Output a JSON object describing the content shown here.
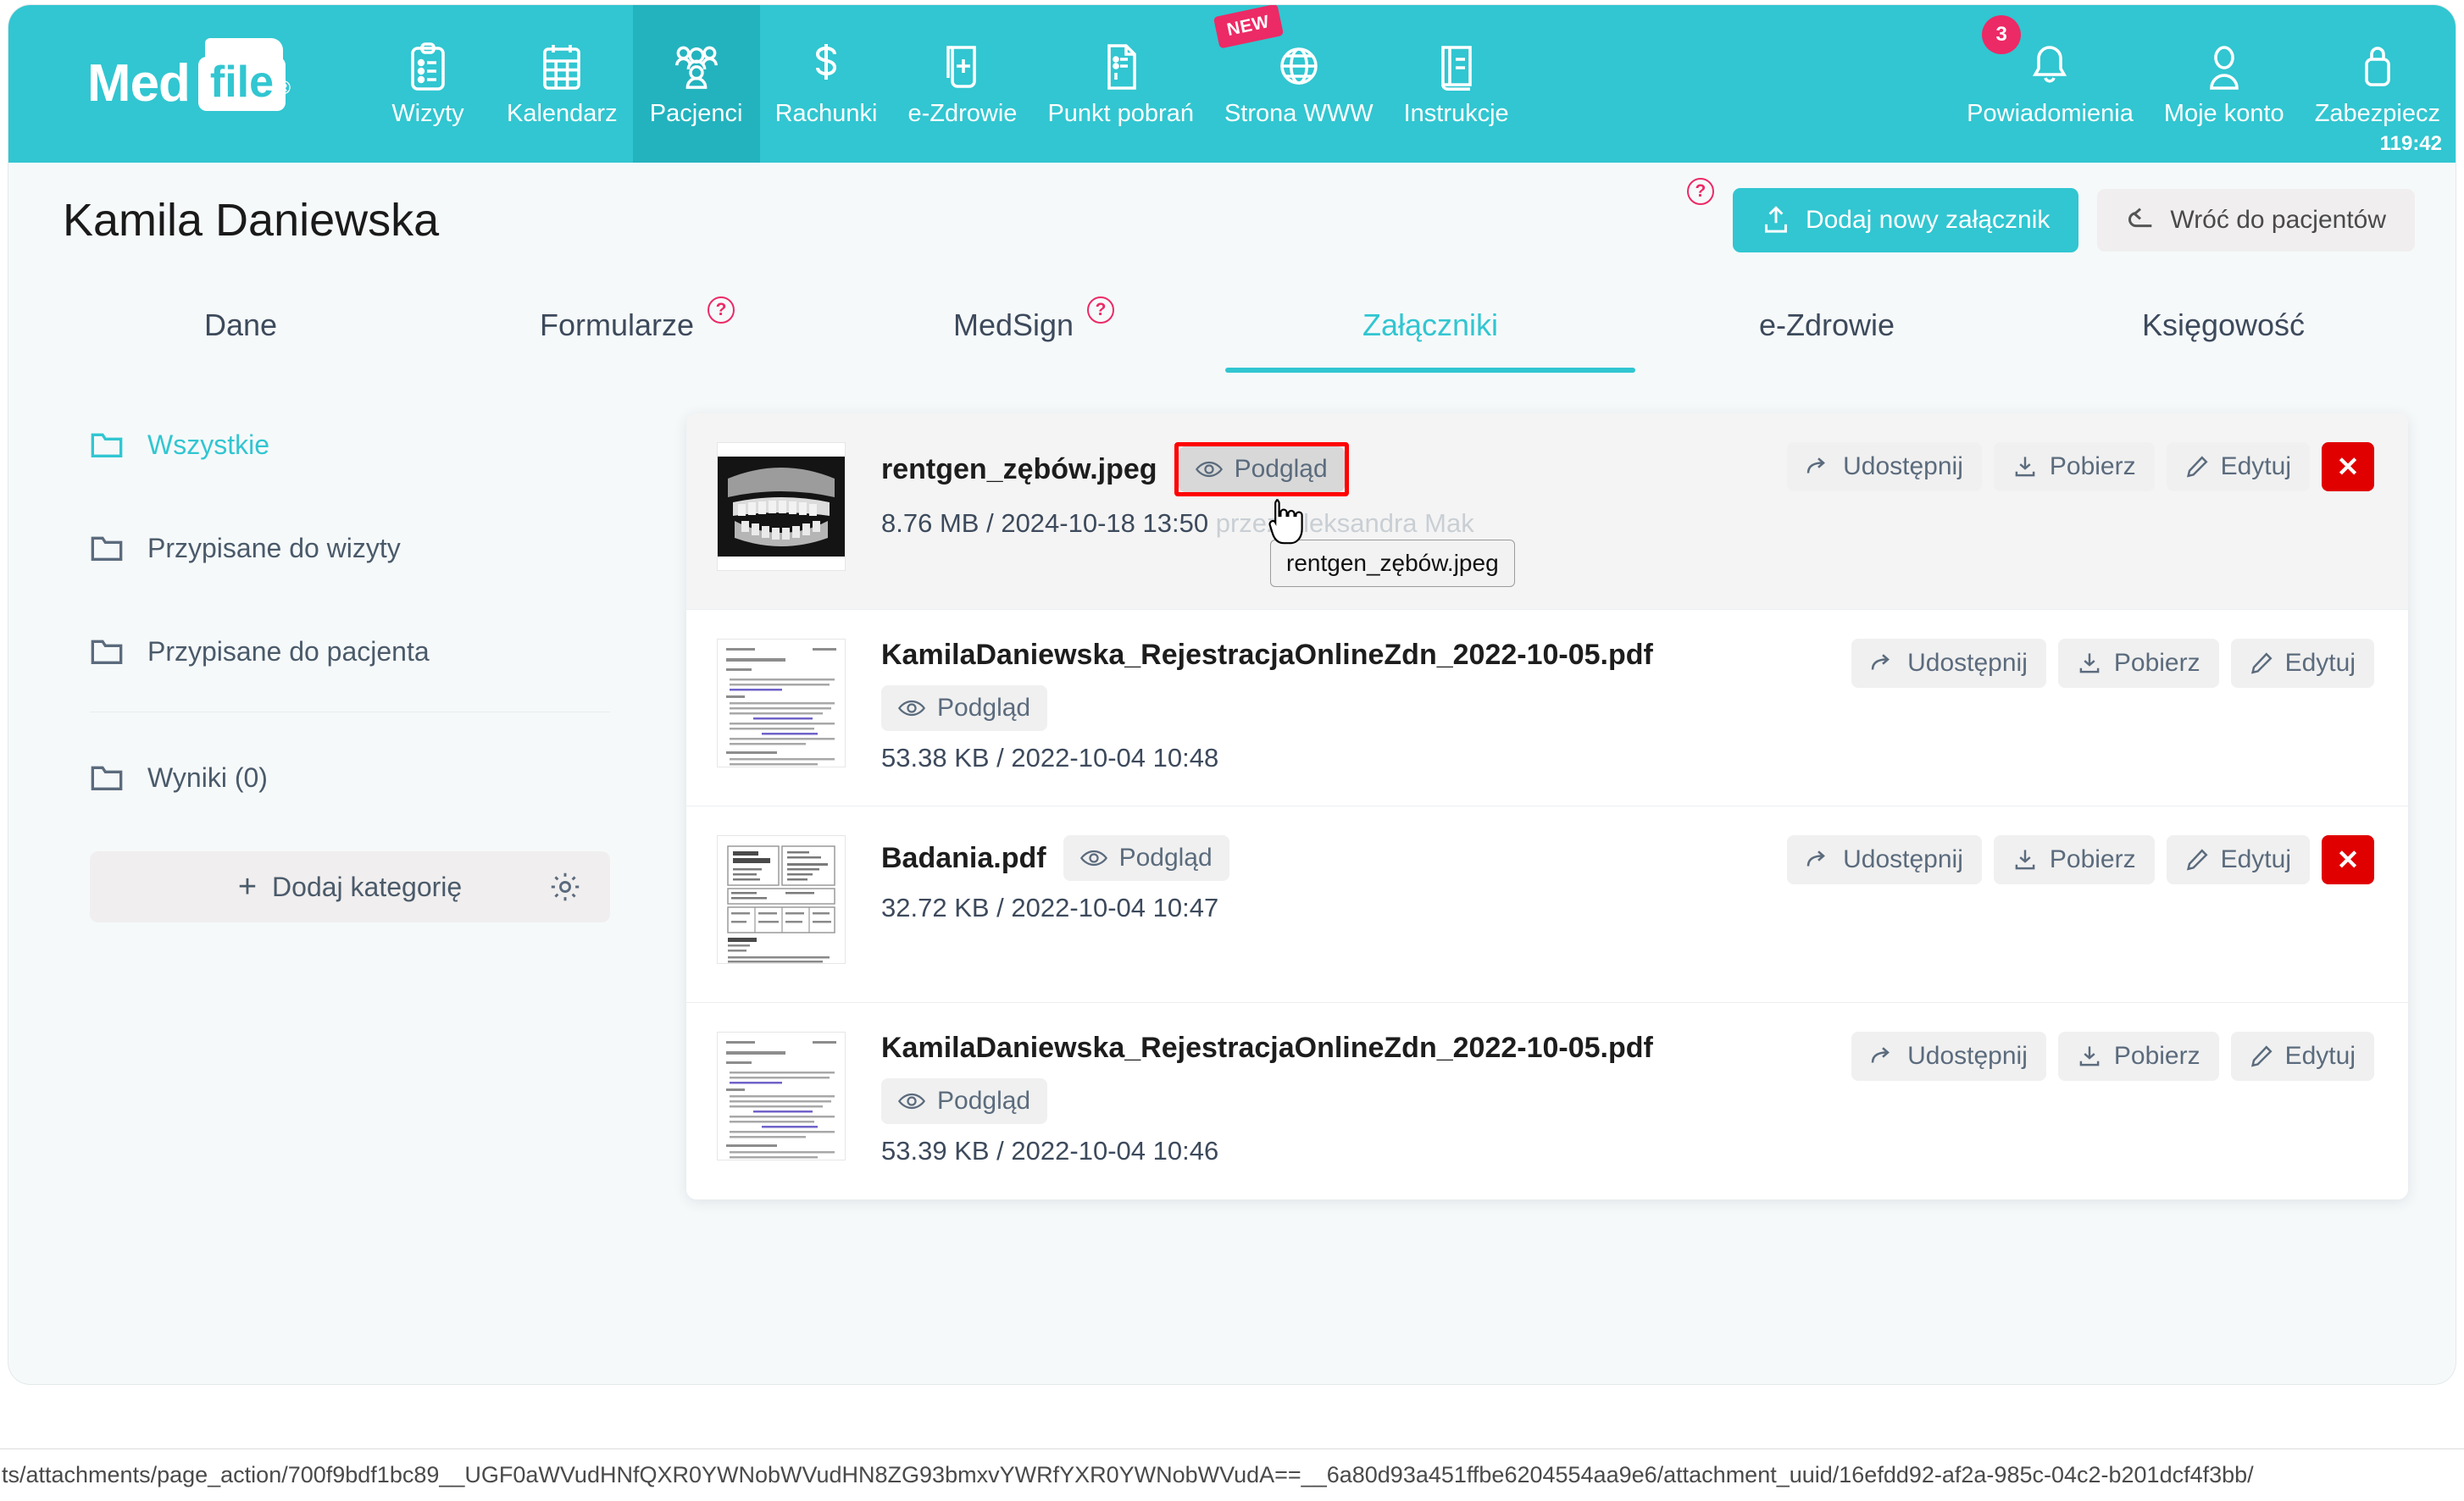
{
  "topnav": {
    "brand": {
      "med": "Med",
      "file": "file",
      "reg": "®"
    },
    "items": [
      {
        "label": "Wizyty",
        "icon": "clipboard-icon",
        "active": false
      },
      {
        "label": "Kalendarz",
        "icon": "calendar-icon",
        "active": false
      },
      {
        "label": "Pacjenci",
        "icon": "patients-icon",
        "active": true
      },
      {
        "label": "Rachunki",
        "icon": "dollar-icon",
        "active": false
      },
      {
        "label": "e-Zdrowie",
        "icon": "medical-record-icon",
        "active": false
      },
      {
        "label": "Punkt pobrań",
        "icon": "document-icon",
        "active": false
      },
      {
        "label": "Strona WWW",
        "icon": "globe-icon",
        "active": false,
        "badge": "NEW"
      },
      {
        "label": "Instrukcje",
        "icon": "book-icon",
        "active": false
      }
    ],
    "right_items": [
      {
        "label": "Powiadomienia",
        "icon": "bell-icon",
        "count": "3"
      },
      {
        "label": "Moje konto",
        "icon": "user-icon"
      },
      {
        "label": "Zabezpiecz",
        "icon": "lock-icon",
        "timer": "119:42"
      }
    ]
  },
  "header": {
    "patient_name": "Kamila Daniewska",
    "help_label": "?",
    "add_attachment_label": "Dodaj nowy załącznik",
    "back_label": "Wróć do pacjentów"
  },
  "tabs": [
    {
      "label": "Dane",
      "active": false,
      "help": false
    },
    {
      "label": "Formularze",
      "active": false,
      "help": true
    },
    {
      "label": "MedSign",
      "active": false,
      "help": true
    },
    {
      "label": "Załączniki",
      "active": true,
      "help": false
    },
    {
      "label": "e-Zdrowie",
      "active": false,
      "help": false
    },
    {
      "label": "Księgowość",
      "active": false,
      "help": false
    }
  ],
  "sidebar": {
    "categories": [
      {
        "label": "Wszystkie",
        "active": true
      },
      {
        "label": "Przypisane do wizyty",
        "active": false
      },
      {
        "label": "Przypisane do pacjenta",
        "active": false
      }
    ],
    "results": {
      "label": "Wyniki (0)"
    },
    "add_category_label": "Dodaj kategorię",
    "add_category_plus": "+"
  },
  "actions": {
    "preview": "Podgląd",
    "share": "Udostępnij",
    "download": "Pobierz",
    "edit": "Edytuj",
    "delete": "✕"
  },
  "attachments": [
    {
      "name": "rentgen_zębów.jpeg",
      "size": "8.76 MB",
      "separator": "/",
      "date": "2024-10-18 13:50",
      "uploaded_by": "przez Aleksandra Mak",
      "thumb": "xray",
      "inline_preview": true,
      "has_delete": true,
      "hovered": true,
      "highlighted": true
    },
    {
      "name": "KamilaDaniewska_RejestracjaOnlineZdn_2022-10-05.pdf",
      "size": "53.38 KB",
      "separator": "/",
      "date": "2022-10-04 10:48",
      "uploaded_by": "",
      "thumb": "doc",
      "inline_preview": false,
      "has_delete": false,
      "hovered": false,
      "highlighted": false
    },
    {
      "name": "Badania.pdf",
      "size": "32.72 KB",
      "separator": "/",
      "date": "2022-10-04 10:47",
      "uploaded_by": "",
      "thumb": "table",
      "inline_preview": true,
      "has_delete": true,
      "hovered": false,
      "highlighted": false
    },
    {
      "name": "KamilaDaniewska_RejestracjaOnlineZdn_2022-10-05.pdf",
      "size": "53.39 KB",
      "separator": "/",
      "date": "2022-10-04 10:46",
      "uploaded_by": "",
      "thumb": "doc",
      "inline_preview": false,
      "has_delete": false,
      "hovered": false,
      "highlighted": false
    }
  ],
  "tooltip": {
    "text": "rentgen_zębów.jpeg"
  },
  "statusbar": {
    "url": "ts/attachments/page_action/700f9bdf1bc89__UGF0aWVudHNfQXR0YWNobWVudHN8ZG93bmxvYWRfYXR0YWNobWVudA==__6a80d93a451ffbe6204554aa9e6/attachment_uuid/16efdd92-af2a-985c-04c2-b201dcf4f3bb/"
  },
  "colors": {
    "brand_teal": "#31c6d1",
    "brand_teal_dark": "#23b3be",
    "accent_pink": "#ec2a66",
    "danger_red": "#e00000",
    "highlight_red": "#ff0000",
    "page_bg": "#f6f9fa"
  }
}
